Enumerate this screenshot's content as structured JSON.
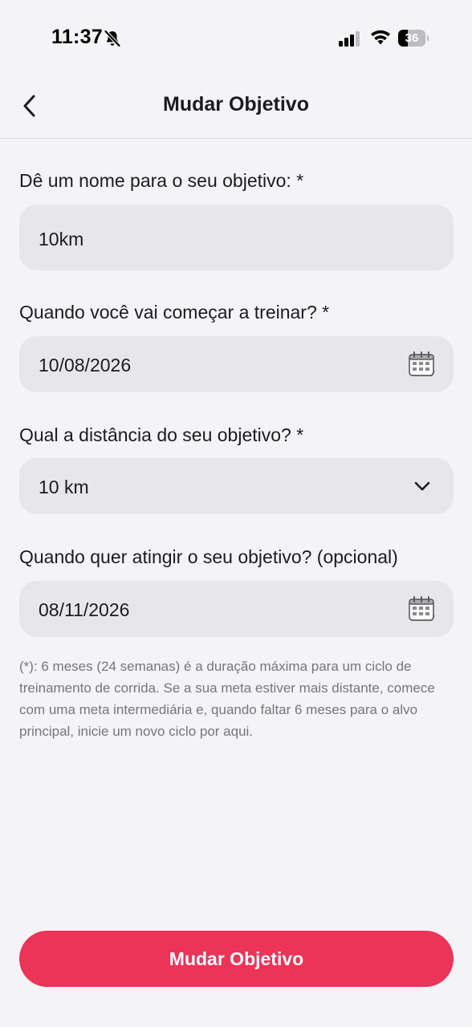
{
  "status_bar": {
    "time": "11:37",
    "battery_level": "36",
    "icons": [
      "bell-off-icon",
      "cellular-signal-icon",
      "wifi-icon",
      "battery-icon"
    ]
  },
  "header": {
    "title": "Mudar Objetivo",
    "back_icon": "chevron-left-icon"
  },
  "form": {
    "goal_name": {
      "label": "Dê um nome para o seu objetivo: *",
      "value": "10km"
    },
    "start_date": {
      "label": "Quando você vai começar a treinar? *",
      "value": "10/08/2026",
      "icon": "calendar-icon"
    },
    "distance": {
      "label": "Qual a distância do seu objetivo? *",
      "value": "10 km",
      "icon": "chevron-down-icon"
    },
    "target_date": {
      "label": "Quando quer atingir o seu objetivo? (opcional)",
      "value": "08/11/2026",
      "icon": "calendar-icon"
    },
    "note": "(*): 6 meses (24 semanas) é a duração máxima para um ciclo de treinamento de corrida. Se a sua meta estiver mais distante, comece com uma meta intermediária e, quando faltar 6 meses para o alvo principal, inicie um novo ciclo por aqui."
  },
  "submit_button": {
    "label": "Mudar Objetivo"
  },
  "colors": {
    "background": "#f4f3f6",
    "field_background": "#e7e7e9",
    "primary": "#ec3358",
    "note_text": "#76767b"
  }
}
